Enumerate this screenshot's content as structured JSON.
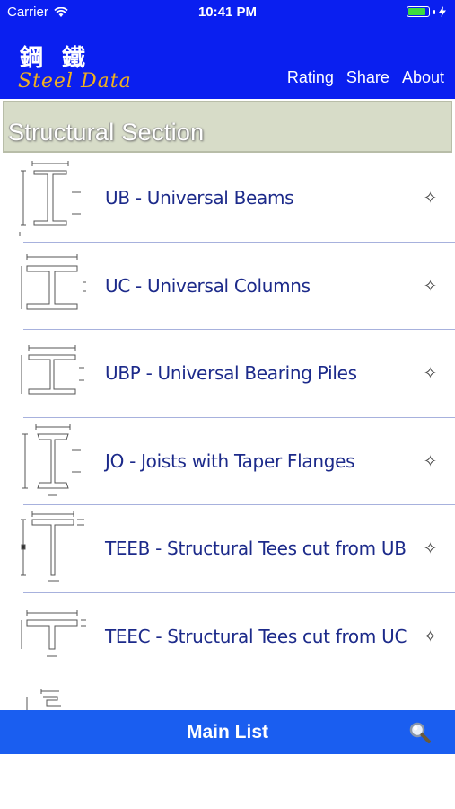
{
  "status": {
    "carrier": "Carrier",
    "time": "10:41 PM"
  },
  "header": {
    "logo_cn": "鋼 鐵",
    "logo_en": "Steel Data",
    "links": [
      "Rating",
      "Share",
      "About"
    ]
  },
  "section": {
    "title": "Structural Section"
  },
  "list": {
    "items": [
      {
        "label": "UB - Universal Beams",
        "icon": "i-beam-diagram-icon"
      },
      {
        "label": "UC - Universal Columns",
        "icon": "h-column-diagram-icon"
      },
      {
        "label": "UBP - Universal Bearing Piles",
        "icon": "bearing-pile-diagram-icon"
      },
      {
        "label": "JO - Joists with Taper Flanges",
        "icon": "joist-diagram-icon"
      },
      {
        "label": "TEEB - Structural Tees cut from UB",
        "icon": "tee-beam-diagram-icon"
      },
      {
        "label": "TEEC - Structural Tees cut from UC",
        "icon": "tee-column-diagram-icon"
      },
      {
        "label": "",
        "icon": "channel-diagram-icon"
      }
    ]
  },
  "tabbar": {
    "title": "Main List",
    "icon": "search-icon"
  },
  "colors": {
    "nav": "#0a1ff0",
    "tabbar": "#1a5ef0",
    "label": "#1c2a8a",
    "section_bg": "#d7dcc8"
  }
}
